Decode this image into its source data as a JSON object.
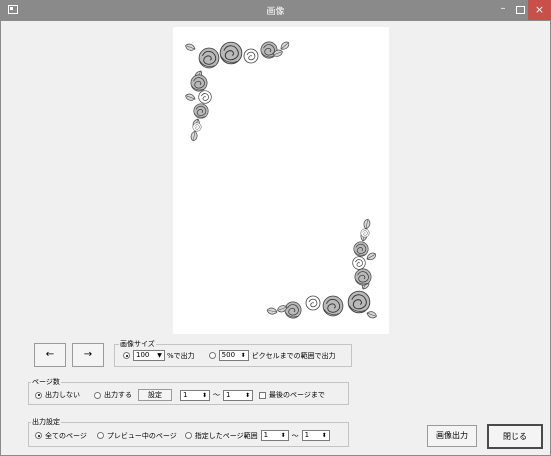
{
  "window": {
    "title": "画像",
    "minimize_glyph": "–",
    "close_glyph": "×"
  },
  "nav": {
    "prev_label": "←",
    "next_label": "→"
  },
  "image_size": {
    "legend": "画像サイズ",
    "percent_value": "100",
    "percent_suffix": "%で出力",
    "pixel_value": "500",
    "pixel_suffix": "ピクセルまでの範囲で出力",
    "selected": "percent"
  },
  "page_count": {
    "legend": "ページ数",
    "no_output_label": "出力しない",
    "output_label": "出力する",
    "setting_button": "設定",
    "from_value": "1",
    "range_sep": "～",
    "to_value": "1",
    "last_page_label": "最後のページまで",
    "selected": "no_output"
  },
  "output_setting": {
    "legend": "出力設定",
    "all_pages_label": "全てのページ",
    "preview_page_label": "プレビュー中のページ",
    "range_label": "指定したページ範囲",
    "from_value": "1",
    "range_sep": "～",
    "to_value": "1",
    "selected": "all_pages"
  },
  "actions": {
    "export_label": "画像出力",
    "close_label": "閉じる"
  }
}
